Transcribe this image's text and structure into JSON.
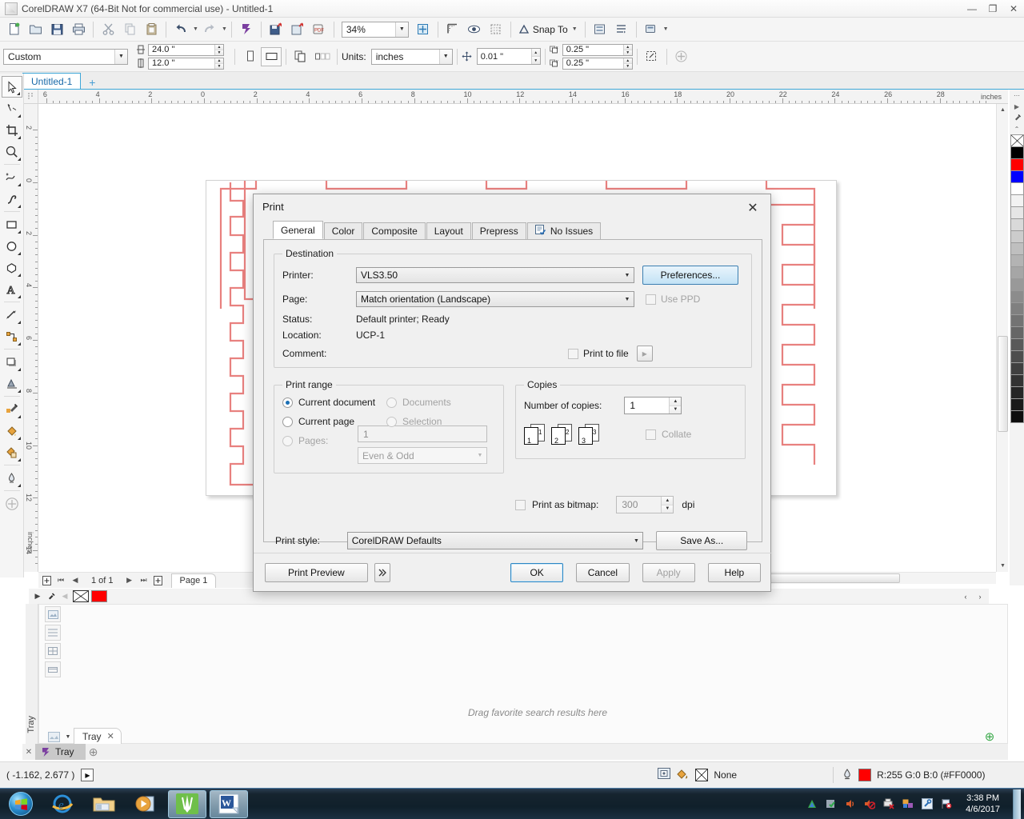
{
  "window": {
    "title": "CorelDRAW X7 (64-Bit Not for commercial use) - Untitled-1",
    "minimize": "—",
    "maximize": "❐",
    "close": "✕"
  },
  "toolbar": {
    "zoom_level": "34%",
    "snap_to_label": "Snap To",
    "icons": [
      "new-document-icon",
      "open-document-icon",
      "save-document-icon",
      "print-icon",
      "cut-icon",
      "copy-icon",
      "paste-icon",
      "undo-icon",
      "redo-icon",
      "import-icon",
      "export-icon",
      "publish-pdf-icon",
      "zoom-levels-icon",
      "full-screen-preview-icon",
      "show-hide-rulers-icon",
      "view-options-icon",
      "snap-to-icon",
      "options-icon",
      "launch-icon"
    ]
  },
  "property_bar": {
    "page_preset": "Custom",
    "page_width": "24.0 \"",
    "page_height": "12.0 \"",
    "units_label": "Units:",
    "units_value": "inches",
    "nudge_value": "0.01 \"",
    "duplicate_x": "0.25 \"",
    "duplicate_y": "0.25 \"",
    "orientation_portrait": "portrait-icon",
    "orientation_landscape": "landscape-icon"
  },
  "document_tab": {
    "label": "Untitled-1",
    "add_label": "+"
  },
  "toolbox": [
    {
      "name": "pick-tool",
      "glyph": "pick"
    },
    {
      "name": "shape-tool",
      "glyph": "shape"
    },
    {
      "name": "crop-tool",
      "glyph": "crop"
    },
    {
      "name": "zoom-tool",
      "glyph": "zoom"
    },
    {
      "name": "freehand-tool",
      "glyph": "freehand"
    },
    {
      "name": "artistic-media-tool",
      "glyph": "media"
    },
    {
      "name": "rectangle-tool",
      "glyph": "rect"
    },
    {
      "name": "ellipse-tool",
      "glyph": "ellipse"
    },
    {
      "name": "polygon-tool",
      "glyph": "polygon"
    },
    {
      "name": "text-tool",
      "glyph": "text"
    },
    {
      "name": "parallel-dimension-tool",
      "glyph": "dimension"
    },
    {
      "name": "straight-line-connector-tool",
      "glyph": "connector"
    },
    {
      "name": "drop-shadow-tool",
      "glyph": "shadow"
    },
    {
      "name": "transparency-tool",
      "glyph": "transparency"
    },
    {
      "name": "color-eyedropper-tool",
      "glyph": "eyedropper"
    },
    {
      "name": "interactive-fill-tool",
      "glyph": "fill"
    },
    {
      "name": "smart-fill-tool",
      "glyph": "smartfill"
    },
    {
      "name": "outline-pen-tool",
      "glyph": "outline"
    },
    {
      "name": "quick-customize-tool",
      "glyph": "plus"
    }
  ],
  "rulers": {
    "unit_label": "inches",
    "h_ticks": [
      "6",
      "4",
      "2",
      "0",
      "2",
      "4",
      "6",
      "8",
      "10",
      "12",
      "14",
      "16",
      "18",
      "20",
      "22",
      "24",
      "26",
      "28"
    ],
    "v_ticks": [
      "2",
      "0",
      "2",
      "4",
      "6",
      "8",
      "10",
      "12",
      "14"
    ]
  },
  "page_navigator": {
    "count_label": "1 of 1",
    "page_tab": "Page 1",
    "first": "⏮",
    "prev": "◀",
    "next": "▶",
    "last": "⏭",
    "add_page": "+"
  },
  "palette": {
    "colors": [
      "none",
      "#000000",
      "#ff0000",
      "#0000ff",
      "#ffffff",
      "#f2f2f2",
      "#e6e6e6",
      "#d9d9d9",
      "#cccccc",
      "#bfbfbf",
      "#b3b3b3",
      "#a6a6a6",
      "#999999",
      "#8c8c8c",
      "#808080",
      "#737373",
      "#666666",
      "#595959",
      "#4d4d4d",
      "#404040",
      "#333333",
      "#262626",
      "#1a1a1a",
      "#0d0d0d"
    ]
  },
  "docker": {
    "hint": "Drag favorite search results here",
    "tab_label": "Tray",
    "tab_close": "✕",
    "side_label": "Tray",
    "add_dock": "⊕"
  },
  "tray_strip": {
    "close": "✕",
    "item_label": "Tray",
    "plus": "⊕"
  },
  "statusbar": {
    "coordinates": "( -1.162, 2.677  )",
    "play_glyph": "▶",
    "fill_label": "None",
    "outline_color_label": "R:255 G:0 B:0 (#FF0000)",
    "outline_color_hex": "#FF0000",
    "icons": [
      "monitor-icon",
      "fill-bucket-icon",
      "outline-pen-icon"
    ]
  },
  "taskbar": {
    "start": "start-orb-icon",
    "apps": [
      {
        "name": "internet-explorer-icon",
        "active": false
      },
      {
        "name": "windows-explorer-icon",
        "active": false
      },
      {
        "name": "media-player-icon",
        "active": false
      },
      {
        "name": "coreldraw-icon",
        "active": true
      },
      {
        "name": "word-icon",
        "active": true
      }
    ],
    "tray_icons": [
      "autodesk-icon",
      "antivirus-icon",
      "volume-icon",
      "volume-muted-icon",
      "printer-error-icon",
      "display-icon",
      "tools-icon",
      "flag-alert-icon"
    ],
    "time": "3:38 PM",
    "date": "4/6/2017"
  },
  "print_dialog": {
    "title": "Print",
    "close": "✕",
    "tabs": [
      {
        "label": "General",
        "active": true,
        "icon": null
      },
      {
        "label": "Color",
        "active": false,
        "icon": null
      },
      {
        "label": "Composite",
        "active": false,
        "icon": null
      },
      {
        "label": "Layout",
        "active": false,
        "icon": null
      },
      {
        "label": "Prepress",
        "active": false,
        "icon": null
      },
      {
        "label": "No Issues",
        "active": false,
        "icon": "preflight-icon"
      }
    ],
    "destination": {
      "legend": "Destination",
      "printer_label": "Printer:",
      "printer_value": "VLS3.50",
      "preferences_button": "Preferences...",
      "page_label": "Page:",
      "page_value": "Match orientation (Landscape)",
      "use_ppd_label": "Use PPD",
      "use_ppd_checked": false,
      "status_label": "Status:",
      "status_value": "Default printer; Ready",
      "location_label": "Location:",
      "location_value": "UCP-1",
      "comment_label": "Comment:",
      "comment_value": "",
      "print_to_file_label": "Print to file",
      "print_to_file_checked": false,
      "print_to_file_more": "▸"
    },
    "print_range": {
      "legend": "Print range",
      "current_document": "Current document",
      "documents": "Documents",
      "current_page": "Current page",
      "selection": "Selection",
      "pages": "Pages:",
      "pages_value": "1",
      "even_odd_value": "Even & Odd",
      "selected": "current_document"
    },
    "copies": {
      "legend": "Copies",
      "number_label": "Number of copies:",
      "number_value": "1",
      "collate_label": "Collate",
      "collate_checked": false,
      "page_icons": [
        "1",
        "2",
        "3"
      ],
      "print_as_bitmap_label": "Print as bitmap:",
      "print_as_bitmap_checked": false,
      "dpi_value": "300",
      "dpi_label": "dpi"
    },
    "print_style": {
      "label": "Print style:",
      "value": "CorelDRAW Defaults",
      "save_as_button": "Save As..."
    },
    "footer": {
      "print_preview": "Print Preview",
      "expand_glyph": "»",
      "ok": "OK",
      "cancel": "Cancel",
      "apply": "Apply",
      "help": "Help"
    }
  }
}
